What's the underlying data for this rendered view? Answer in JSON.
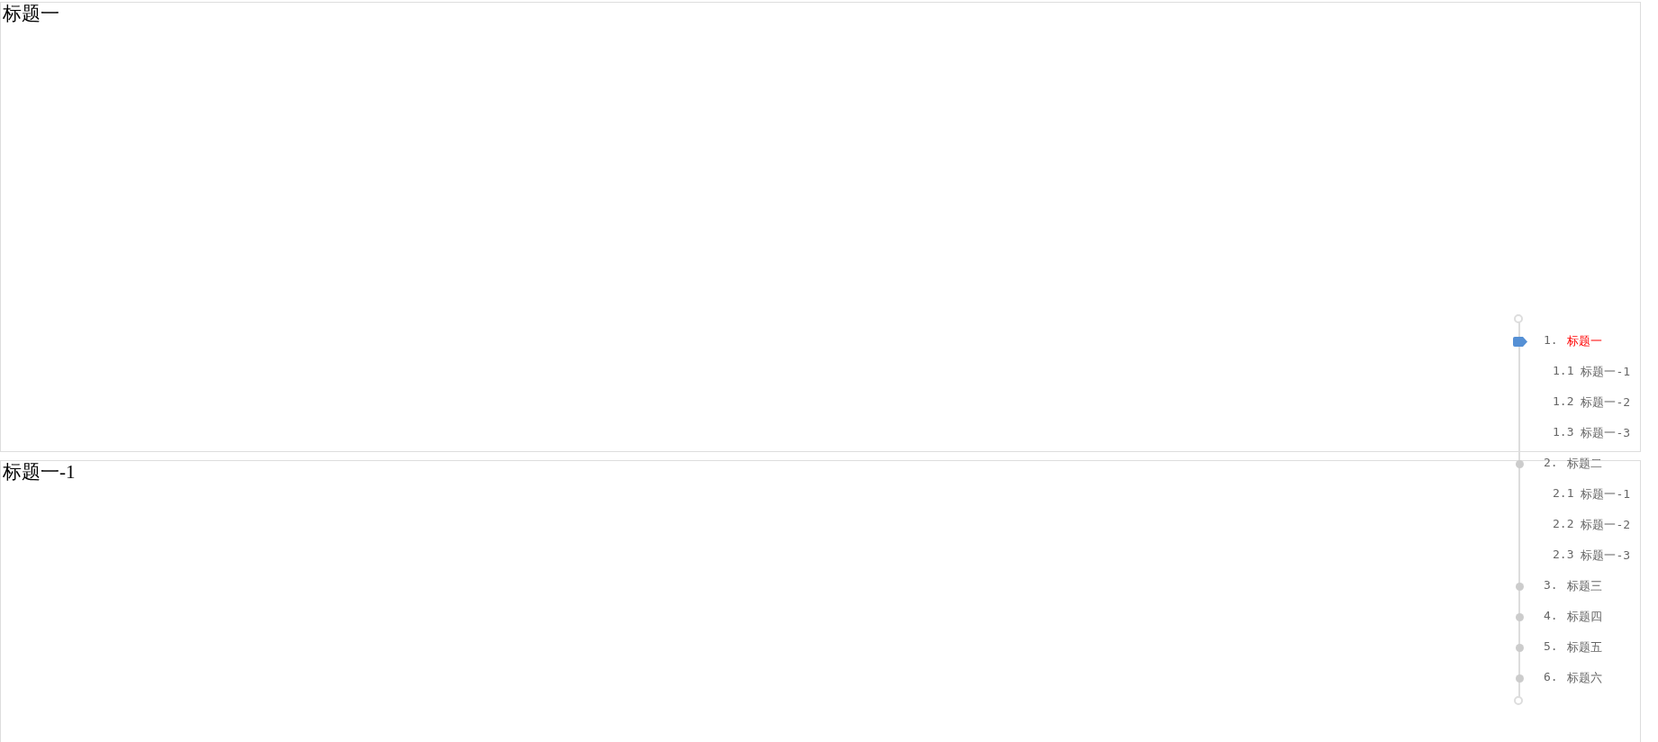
{
  "sections": [
    {
      "title": "标题一"
    },
    {
      "title": "标题一-1"
    }
  ],
  "nav": {
    "items": [
      {
        "number": "1.",
        "label": "标题一",
        "selected": true,
        "children": [
          {
            "number": "1.1",
            "label": "标题一-1"
          },
          {
            "number": "1.2",
            "label": "标题一-2"
          },
          {
            "number": "1.3",
            "label": "标题一-3"
          }
        ]
      },
      {
        "number": "2.",
        "label": "标题二",
        "selected": false,
        "children": [
          {
            "number": "2.1",
            "label": "标题一-1"
          },
          {
            "number": "2.2",
            "label": "标题一-2"
          },
          {
            "number": "2.3",
            "label": "标题一-3"
          }
        ]
      },
      {
        "number": "3.",
        "label": "标题三",
        "selected": false
      },
      {
        "number": "4.",
        "label": "标题四",
        "selected": false
      },
      {
        "number": "5.",
        "label": "标题五",
        "selected": false
      },
      {
        "number": "6.",
        "label": "标题六",
        "selected": false
      }
    ]
  }
}
